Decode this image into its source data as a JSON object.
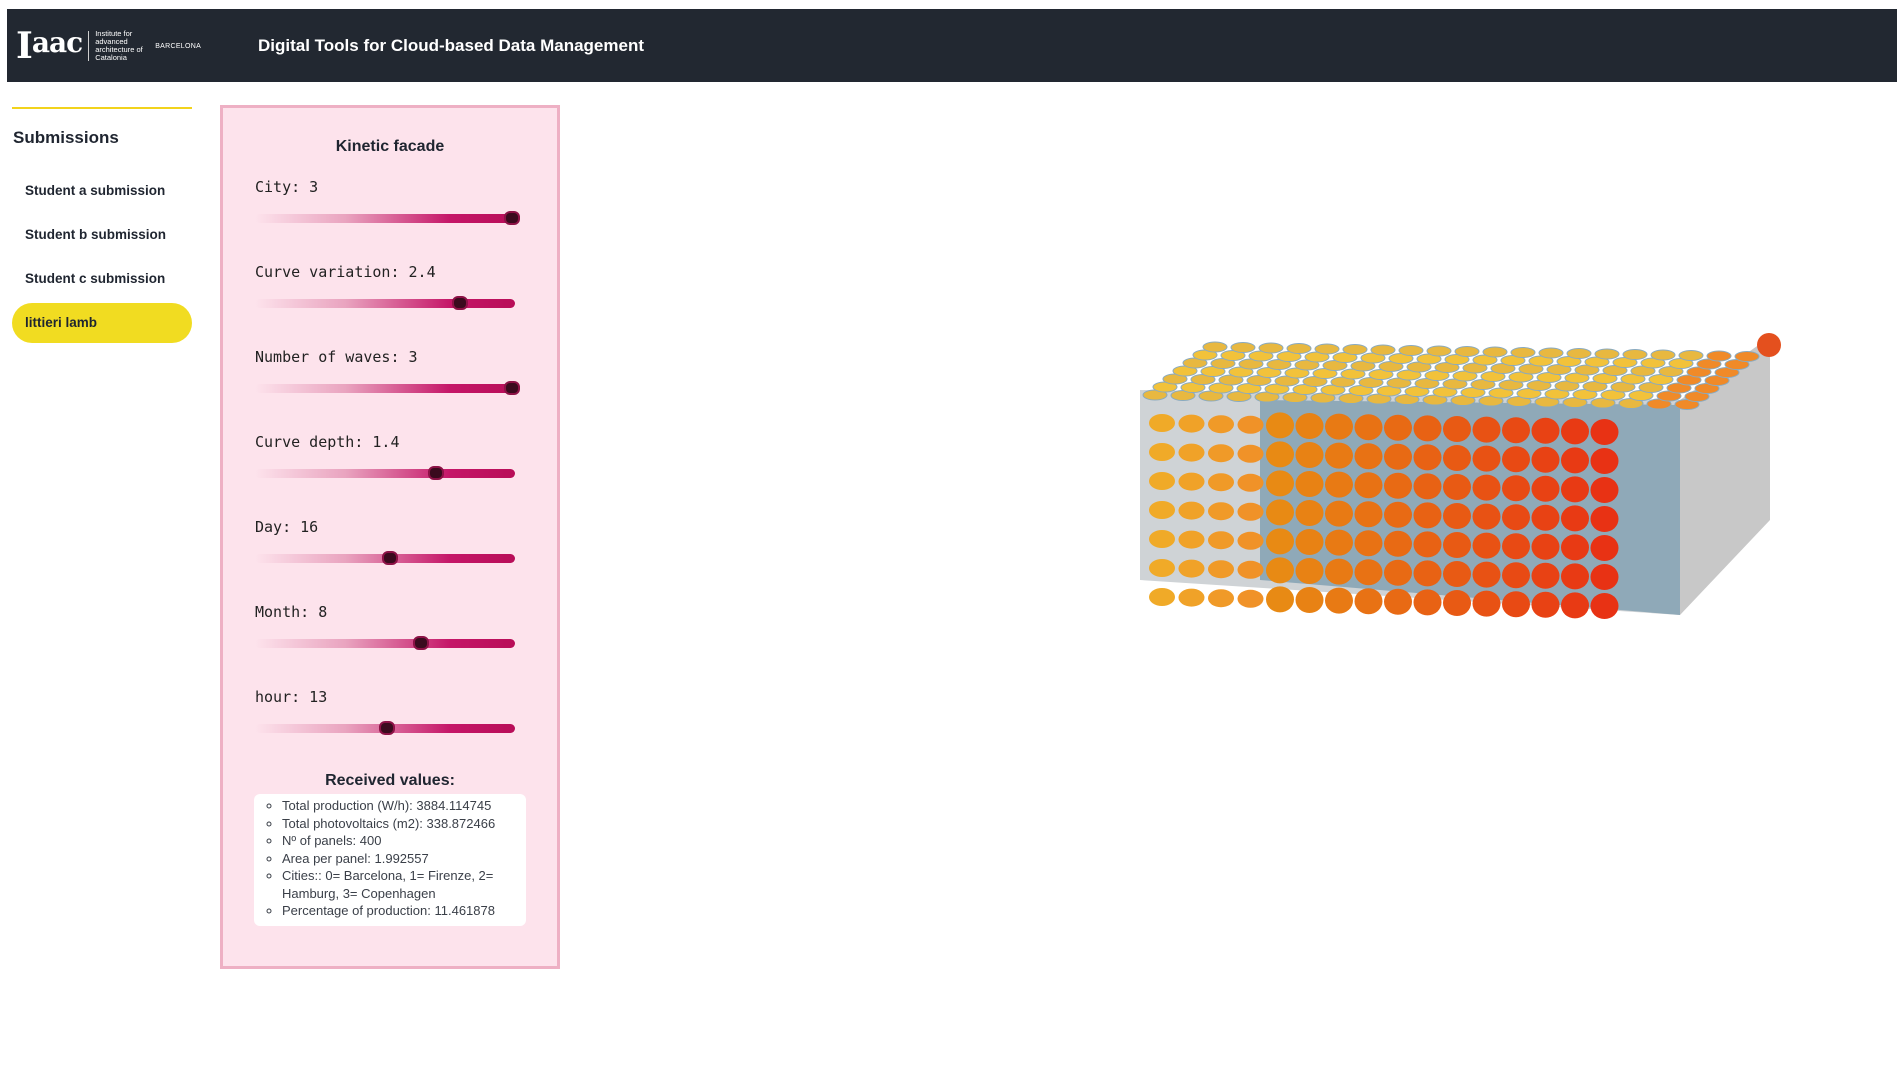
{
  "header": {
    "logo_mark": "IaaC",
    "logo_institute": "Institute for advanced architecture of Catalonia",
    "logo_city": "BARCELONA",
    "title": "Digital Tools for Cloud-based Data Management"
  },
  "sidebar": {
    "heading": "Submissions",
    "items": [
      {
        "label": "Student a submission",
        "active": false
      },
      {
        "label": "Student b submission",
        "active": false
      },
      {
        "label": "Student c submission",
        "active": false
      },
      {
        "label": "littieri lamb",
        "active": true
      }
    ]
  },
  "panel": {
    "title": "Kinetic facade",
    "sliders": [
      {
        "label": "City: 3",
        "level": 0.98
      },
      {
        "label": "Curve variation: 2.4",
        "level": 0.78
      },
      {
        "label": "Number of waves: 3",
        "level": 0.98
      },
      {
        "label": "Curve depth: 1.4",
        "level": 0.69
      },
      {
        "label": "Day: 16",
        "level": 0.51
      },
      {
        "label": "Month: 8",
        "level": 0.63
      },
      {
        "label": "hour: 13",
        "level": 0.5
      }
    ],
    "received_title": "Received values:",
    "received": [
      "Total production (W/h): 3884.114745",
      "Total photovoltaics (m2): 338.872466",
      "Nº of panels: 400",
      "Area per panel: 1.992557",
      "Cities:: 0= Barcelona, 1= Firenze, 2= Hamburg, 3= Copenhagen",
      "Percentage of production: 11.461878"
    ]
  },
  "colors": {
    "header_bg": "#222831",
    "accent_yellow": "#f1dc21",
    "panel_bg": "#fde3ec",
    "panel_border": "#eeb0c4",
    "slider_fill": "#c51668"
  }
}
